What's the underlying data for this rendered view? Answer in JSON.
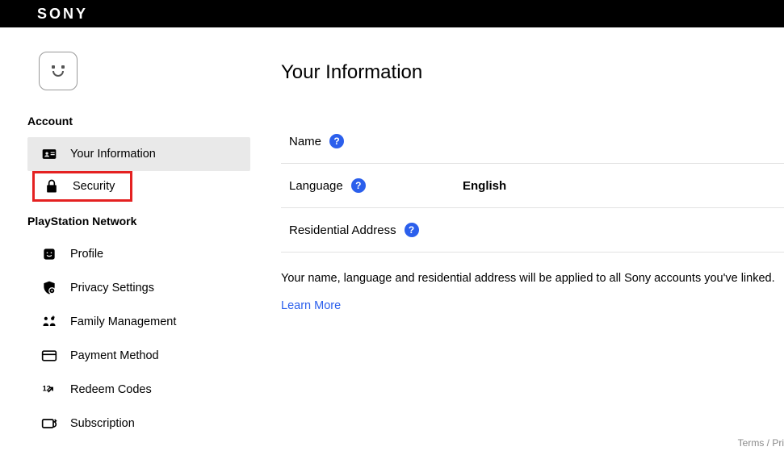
{
  "brand": "SONY",
  "sidebar": {
    "sections": [
      {
        "heading": "Account",
        "items": [
          {
            "label": "Your Information",
            "icon": "id-card-icon",
            "active": true
          },
          {
            "label": "Security",
            "icon": "lock-icon",
            "highlight": true
          }
        ]
      },
      {
        "heading": "PlayStation Network",
        "items": [
          {
            "label": "Profile",
            "icon": "profile-icon"
          },
          {
            "label": "Privacy Settings",
            "icon": "shield-gear-icon"
          },
          {
            "label": "Family Management",
            "icon": "family-icon"
          },
          {
            "label": "Payment Method",
            "icon": "credit-card-icon"
          },
          {
            "label": "Redeem Codes",
            "icon": "redeem-icon"
          },
          {
            "label": "Subscription",
            "icon": "subscription-icon"
          }
        ]
      }
    ]
  },
  "main": {
    "title": "Your Information",
    "rows": [
      {
        "label": "Name",
        "value": ""
      },
      {
        "label": "Language",
        "value": "English"
      },
      {
        "label": "Residential Address",
        "value": ""
      }
    ],
    "note": "Your name, language and residential address will be applied to all Sony accounts you've linked.",
    "learn_more": "Learn More"
  },
  "footer": "Terms / Pri"
}
